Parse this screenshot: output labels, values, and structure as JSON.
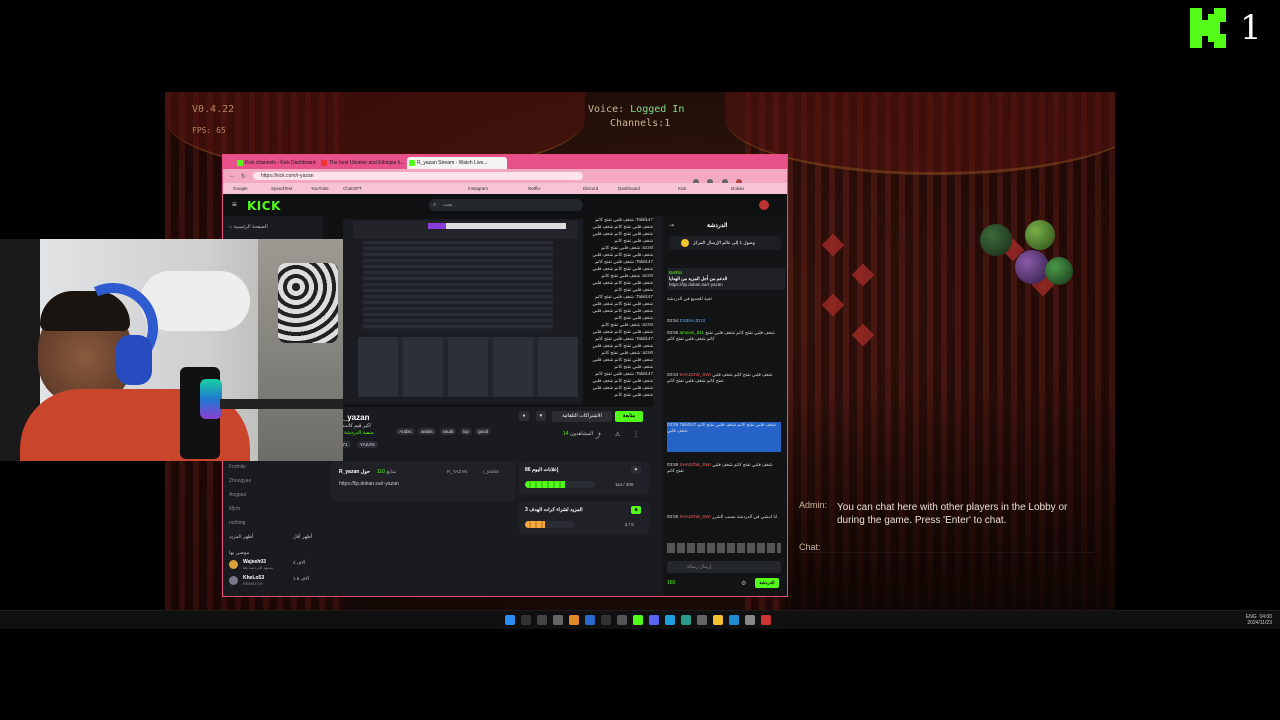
{
  "overlay": {
    "kick_brand_number": "1",
    "voice_label": "Voice:",
    "voice_status": "Logged In",
    "channels_label": "Channels:",
    "channels_value": "1",
    "fps_label": "FPS:",
    "fps_value": "65",
    "version_text": "V0.4.22"
  },
  "browser": {
    "tabs": [
      {
        "label": "Kick channels - Kick Dashboard"
      },
      {
        "label": "The best Ukraine and Ethiopia h..."
      },
      {
        "label": "R_yazan Stream - Watch Live..."
      }
    ],
    "url": "https://kick.com/r-yazan",
    "bookmarks": [
      "Google",
      "SpeedTest",
      "YouTube",
      "ChatGPT",
      "Instagram",
      "Netflix",
      "Discord",
      "Dashboard",
      "Kick",
      "Dokan"
    ]
  },
  "kick": {
    "logo": "KICK",
    "search_placeholder": "بحث",
    "sidebar_home": "الصفحة الرئيسية",
    "sidebar_following": [
      {
        "name": "Fortnite"
      },
      {
        "name": "Zhongyao"
      },
      {
        "name": "Angpao"
      },
      {
        "name": "Mjrm"
      },
      {
        "name": "nothing"
      }
    ],
    "sidebar_show_more": "أظهر المزيد",
    "sidebar_show_less": "أظهر أقل",
    "sidebar_recommended": "موصى بها",
    "recommended": [
      {
        "name": "Wajeeh03",
        "sub": "مشهد الدردشة هنا",
        "viewers": "2 آلاف"
      },
      {
        "name": "KheLo53",
        "sub": "REMATCH",
        "viewers": "1.5 آلاف"
      }
    ],
    "streamer": {
      "name": "R_yazan",
      "title": "!!!!اكبر قيم كانت",
      "subtitle": "منصة الدردشة هنا",
      "tags": [
        "Arabic",
        "arabic",
        "saudi",
        "top",
        "good"
      ],
      "followers_badge": "171",
      "category": "YAZAN",
      "viewers_label": "المشاهدون",
      "viewers_count": "14",
      "follow_button": "متابعة",
      "subscribe_button": "الاشتراكات التلقائية"
    },
    "about": {
      "heading": "حول",
      "name": "R_yazan",
      "followers": "110",
      "followers_label": "متابع",
      "link": "https://lip.dokan.sa/r-yazan",
      "social_1": "R_YAZAN",
      "social_2": "r_yazan"
    },
    "goals": [
      {
        "title": "إعلانات اليوم 86",
        "progress_text": "114 / 200",
        "progress": 0.57
      },
      {
        "title": "المزيد لشراء كرات الهدف 3",
        "progress_text": "2 / 5",
        "progress": 0.4
      }
    ],
    "chat": {
      "title": "الدردشة",
      "pinned": "وصول 1 إلى عالم الإرسال المركز",
      "pinned_link": "https://lip.dokan.sa/r-yazan",
      "pinned_text": "الدعم من أجل المزيد من الهدايا",
      "messages": [
        {
          "time": "03:54",
          "user": "BotRix",
          "color": "green",
          "text": "تحية للجميع في الدردشة"
        },
        {
          "time": "03:54",
          "user": "EXBNAJD10",
          "color": "blue",
          "text": ""
        },
        {
          "time": "03:55",
          "user": "amnani_511",
          "color": "green",
          "text": "شغف قلبي تفتح كاتم شغف قلبي تفتح كاتم شغف قلبي تفتح كاتم"
        },
        {
          "time": "03:54",
          "user": "SHADOW_SWI",
          "color": "red",
          "text": "شغف قلبي تفتح كاتم شغف قلبي تفتح كاتم شغف قلبي تفتح كاتم"
        },
        {
          "time": "03:55",
          "user": "Talal147",
          "color": "blue",
          "text": "شغف قلبي تفتح كاتم شغف قلبي تفتح كاتم شغف قلبي"
        },
        {
          "time": "03:55",
          "user": "SHADOW_SWI",
          "color": "red",
          "text": "شغف قلبي تفتح كاتم شغف قلبي تفتح كاتم"
        },
        {
          "time": "03:55",
          "user": "SHADOW_SWI",
          "color": "red",
          "text": "أنا أمشي في الدردشة بسبب الشرر"
        }
      ],
      "input_placeholder": "إرسال رسالة",
      "send_button": "الدردشة",
      "points": "160"
    },
    "wall_lines": [
      "Talal147: شغف قلبي تفتح كاتم",
      "شغف قلبي تفتح كاتم شغف قلبي",
      "شغف قلبي تفتح كاتم شغف قلبي",
      "شغف قلبي تفتح كاتم",
      "azzi0: شغف قلبي تفتح كاتم",
      "شغف قلبي تفتح كاتم شغف قلبي",
      "Talal147: شغف قلبي تفتح كاتم",
      "شغف قلبي تفتح كاتم شغف قلبي",
      "azzi0: شغف قلبي تفتح كاتم",
      "شغف قلبي تفتح كاتم شغف قلبي",
      "شغف قلبي تفتح كاتم"
    ]
  },
  "game_chat": {
    "admin_label": "Admin:",
    "admin_message": "You can chat here with other players in the Lobby or during the game. Press 'Enter' to chat.",
    "chat_label": "Chat:"
  },
  "taskbar": {
    "time": "04:00",
    "date": "2024/11/23",
    "lang": "ENG"
  },
  "colors": {
    "kick_green": "#53fc18",
    "browser_pink": "#e8508a",
    "goal_orange": "#f4a940"
  }
}
